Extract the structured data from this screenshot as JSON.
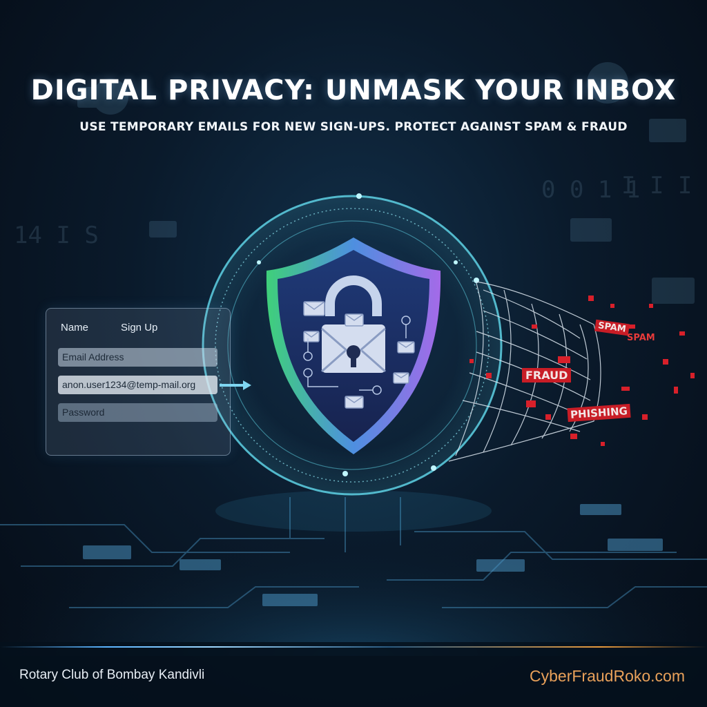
{
  "title": "DIGITAL PRIVACY: UNMASK YOUR INBOX",
  "subtitle": "USE TEMPORARY EMAILS FOR NEW SIGN-UPS. PROTECT AGAINST SPAM & FRAUD",
  "form": {
    "tabs": [
      "Name",
      "Sign Up"
    ],
    "email_placeholder": "Email Address",
    "temp_email": "anon.user1234@temp-mail.org",
    "password_placeholder": "Password"
  },
  "threats": [
    "SPAM",
    "SPAM",
    "FRAUD",
    "PHISHING"
  ],
  "footer": {
    "left": "Rotary Club of Bombay Kandivli",
    "right": "CyberFraudRoko.com"
  },
  "colors": {
    "background": "#0a1a2b",
    "glow": "#5fd3e6",
    "shield_green": "#3fd07a",
    "shield_purple": "#a46ae8",
    "threat_red": "#d8202a",
    "footer_accent": "#e9a15a"
  }
}
